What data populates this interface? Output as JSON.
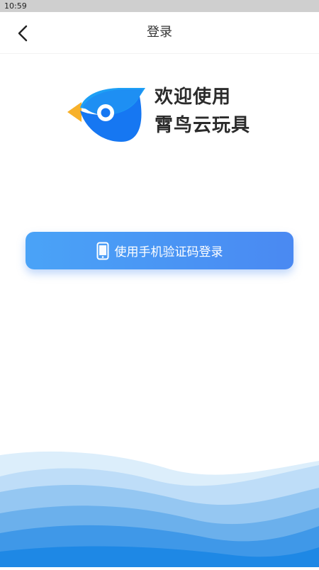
{
  "status_bar": {
    "time": "10:59"
  },
  "nav": {
    "title": "登录",
    "back_icon": "chevron-left-icon"
  },
  "welcome": {
    "line1": "欢迎使用",
    "line2": "霄鸟云玩具"
  },
  "login": {
    "phone_button_label": "使用手机验证码登录",
    "icon": "phone-icon"
  },
  "colors": {
    "accent": "#4A90F2",
    "logo_blue": "#1677F2",
    "logo_light_blue": "#1EA0F5",
    "logo_orange": "#F7B12B",
    "wave_light": "#D8ECFB",
    "wave_dark": "#1E88E5"
  }
}
